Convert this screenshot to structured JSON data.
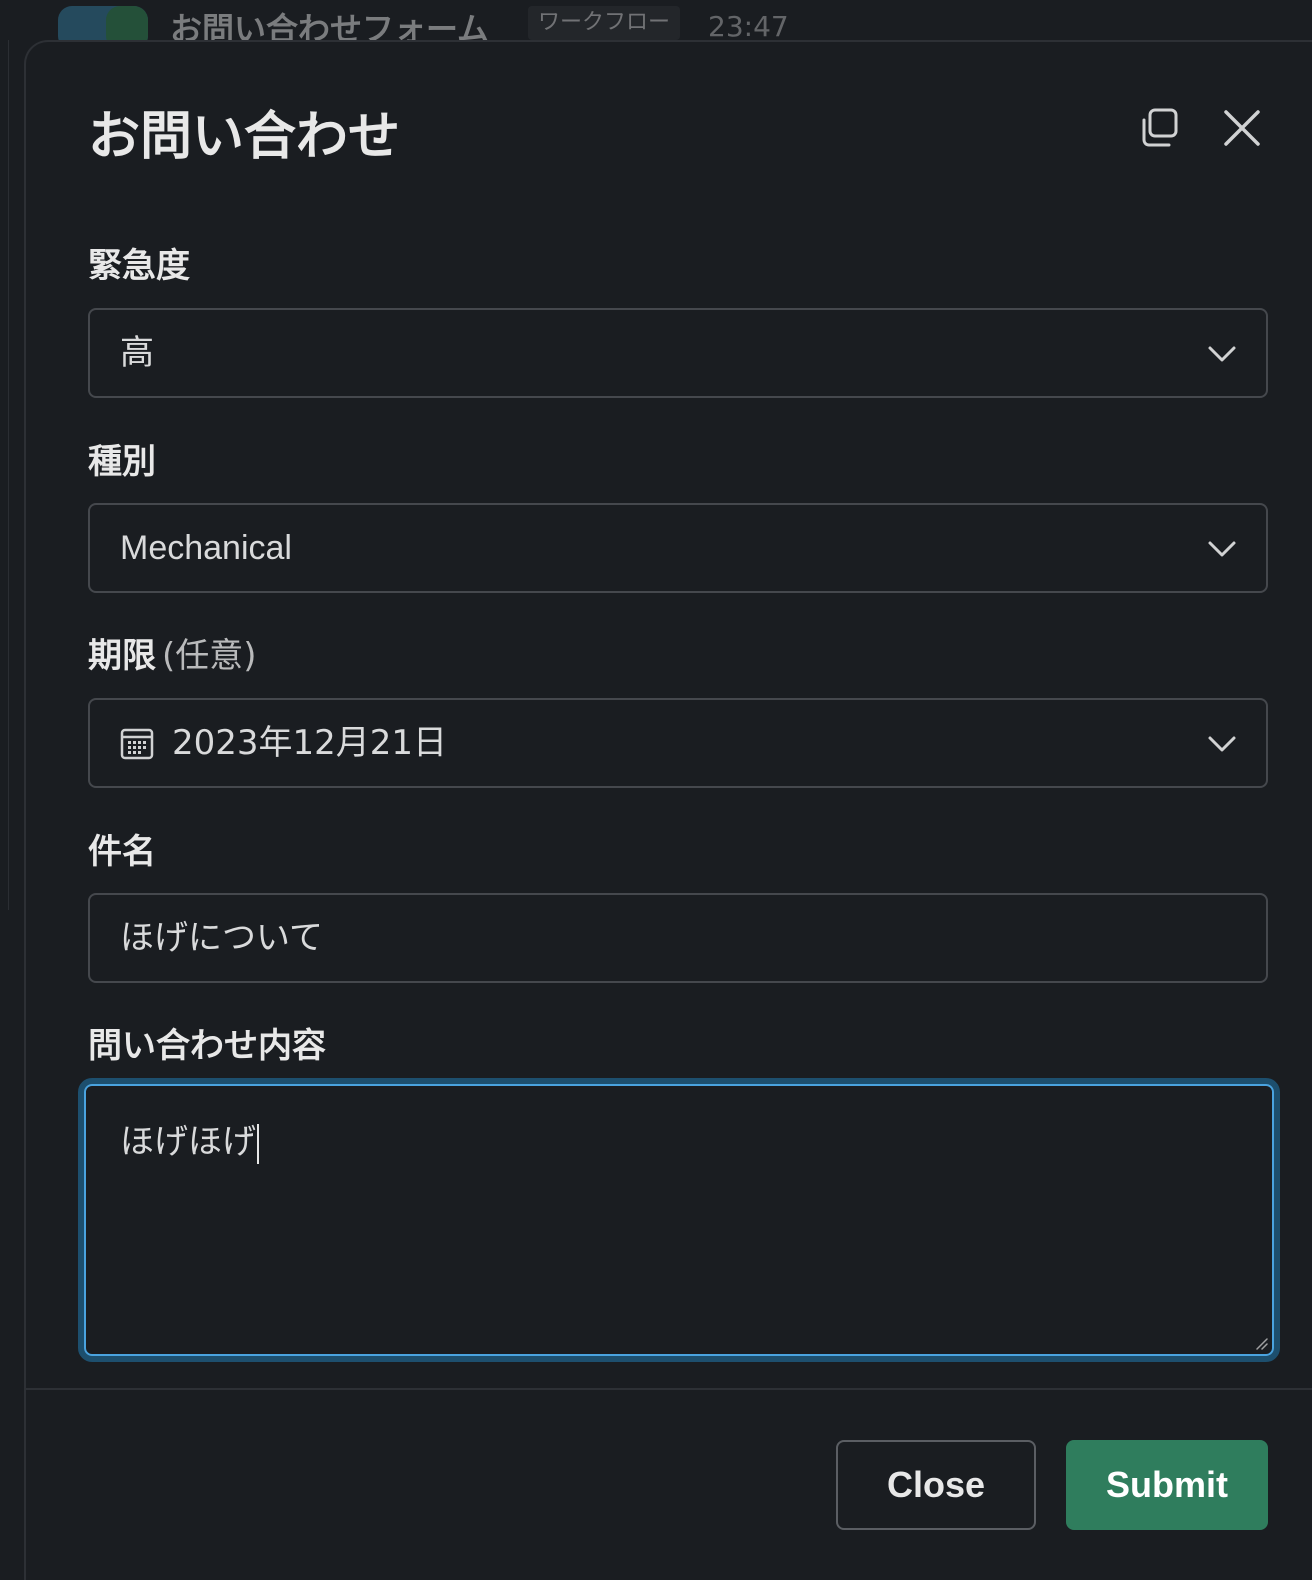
{
  "background": {
    "message_title": "お問い合わせフォーム",
    "tag": "ワークフロー",
    "time": "23:47"
  },
  "modal": {
    "title": "お問い合わせ",
    "copy_icon": "copy-icon",
    "close_icon": "close-icon"
  },
  "fields": {
    "urgency": {
      "label": "緊急度",
      "value": "高"
    },
    "category": {
      "label": "種別",
      "value": "Mechanical"
    },
    "deadline": {
      "label": "期限",
      "optional": "(任意)",
      "value": "2023年12月21日",
      "icon": "calendar-icon"
    },
    "subject": {
      "label": "件名",
      "value": "ほげについて"
    },
    "content": {
      "label": "問い合わせ内容",
      "value": "ほげほげ"
    }
  },
  "footer": {
    "close_label": "Close",
    "submit_label": "Submit"
  },
  "colors": {
    "accent": "#4aa3df",
    "submit": "#2f7d5d",
    "background": "#1a1d21"
  }
}
